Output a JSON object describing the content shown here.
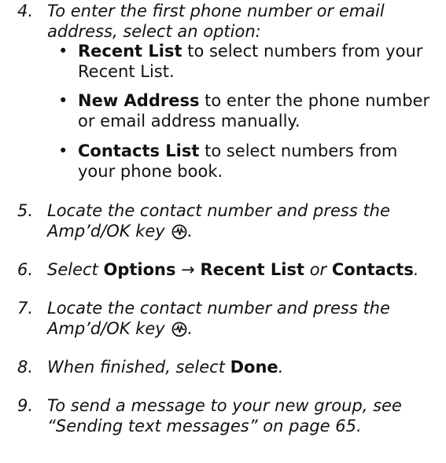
{
  "steps": [
    {
      "num": "4.",
      "text": "To enter the first phone number or email address, select an option:"
    },
    {
      "num": "5.",
      "text": "Locate the contact number and press the Amp’d/OK key"
    },
    {
      "num": "6.",
      "select": "Select",
      "options": "Options",
      "arrow": "→",
      "recent": "Recent List",
      "or": "or",
      "contacts": "Contacts",
      "period": "."
    },
    {
      "num": "7.",
      "text": "Locate the contact number and press the Amp’d/OK key"
    },
    {
      "num": "8.",
      "text": "When finished, select",
      "bold": "Done",
      "period": "."
    },
    {
      "num": "9.",
      "text": "To send a message to your new group, see “Sending text messages” on page 65."
    }
  ],
  "bullets": [
    {
      "dot": "•",
      "bold": "Recent List",
      "text": "to select numbers from your Recent List."
    },
    {
      "dot": "•",
      "bold": "New Address",
      "text": "to enter the phone number or email address manually."
    },
    {
      "dot": "•",
      "bold": "Contacts List",
      "text": "to select numbers from your phone book."
    }
  ],
  "key_period": ".",
  "icons": {
    "ok_key": "amp-ok-key-icon"
  }
}
